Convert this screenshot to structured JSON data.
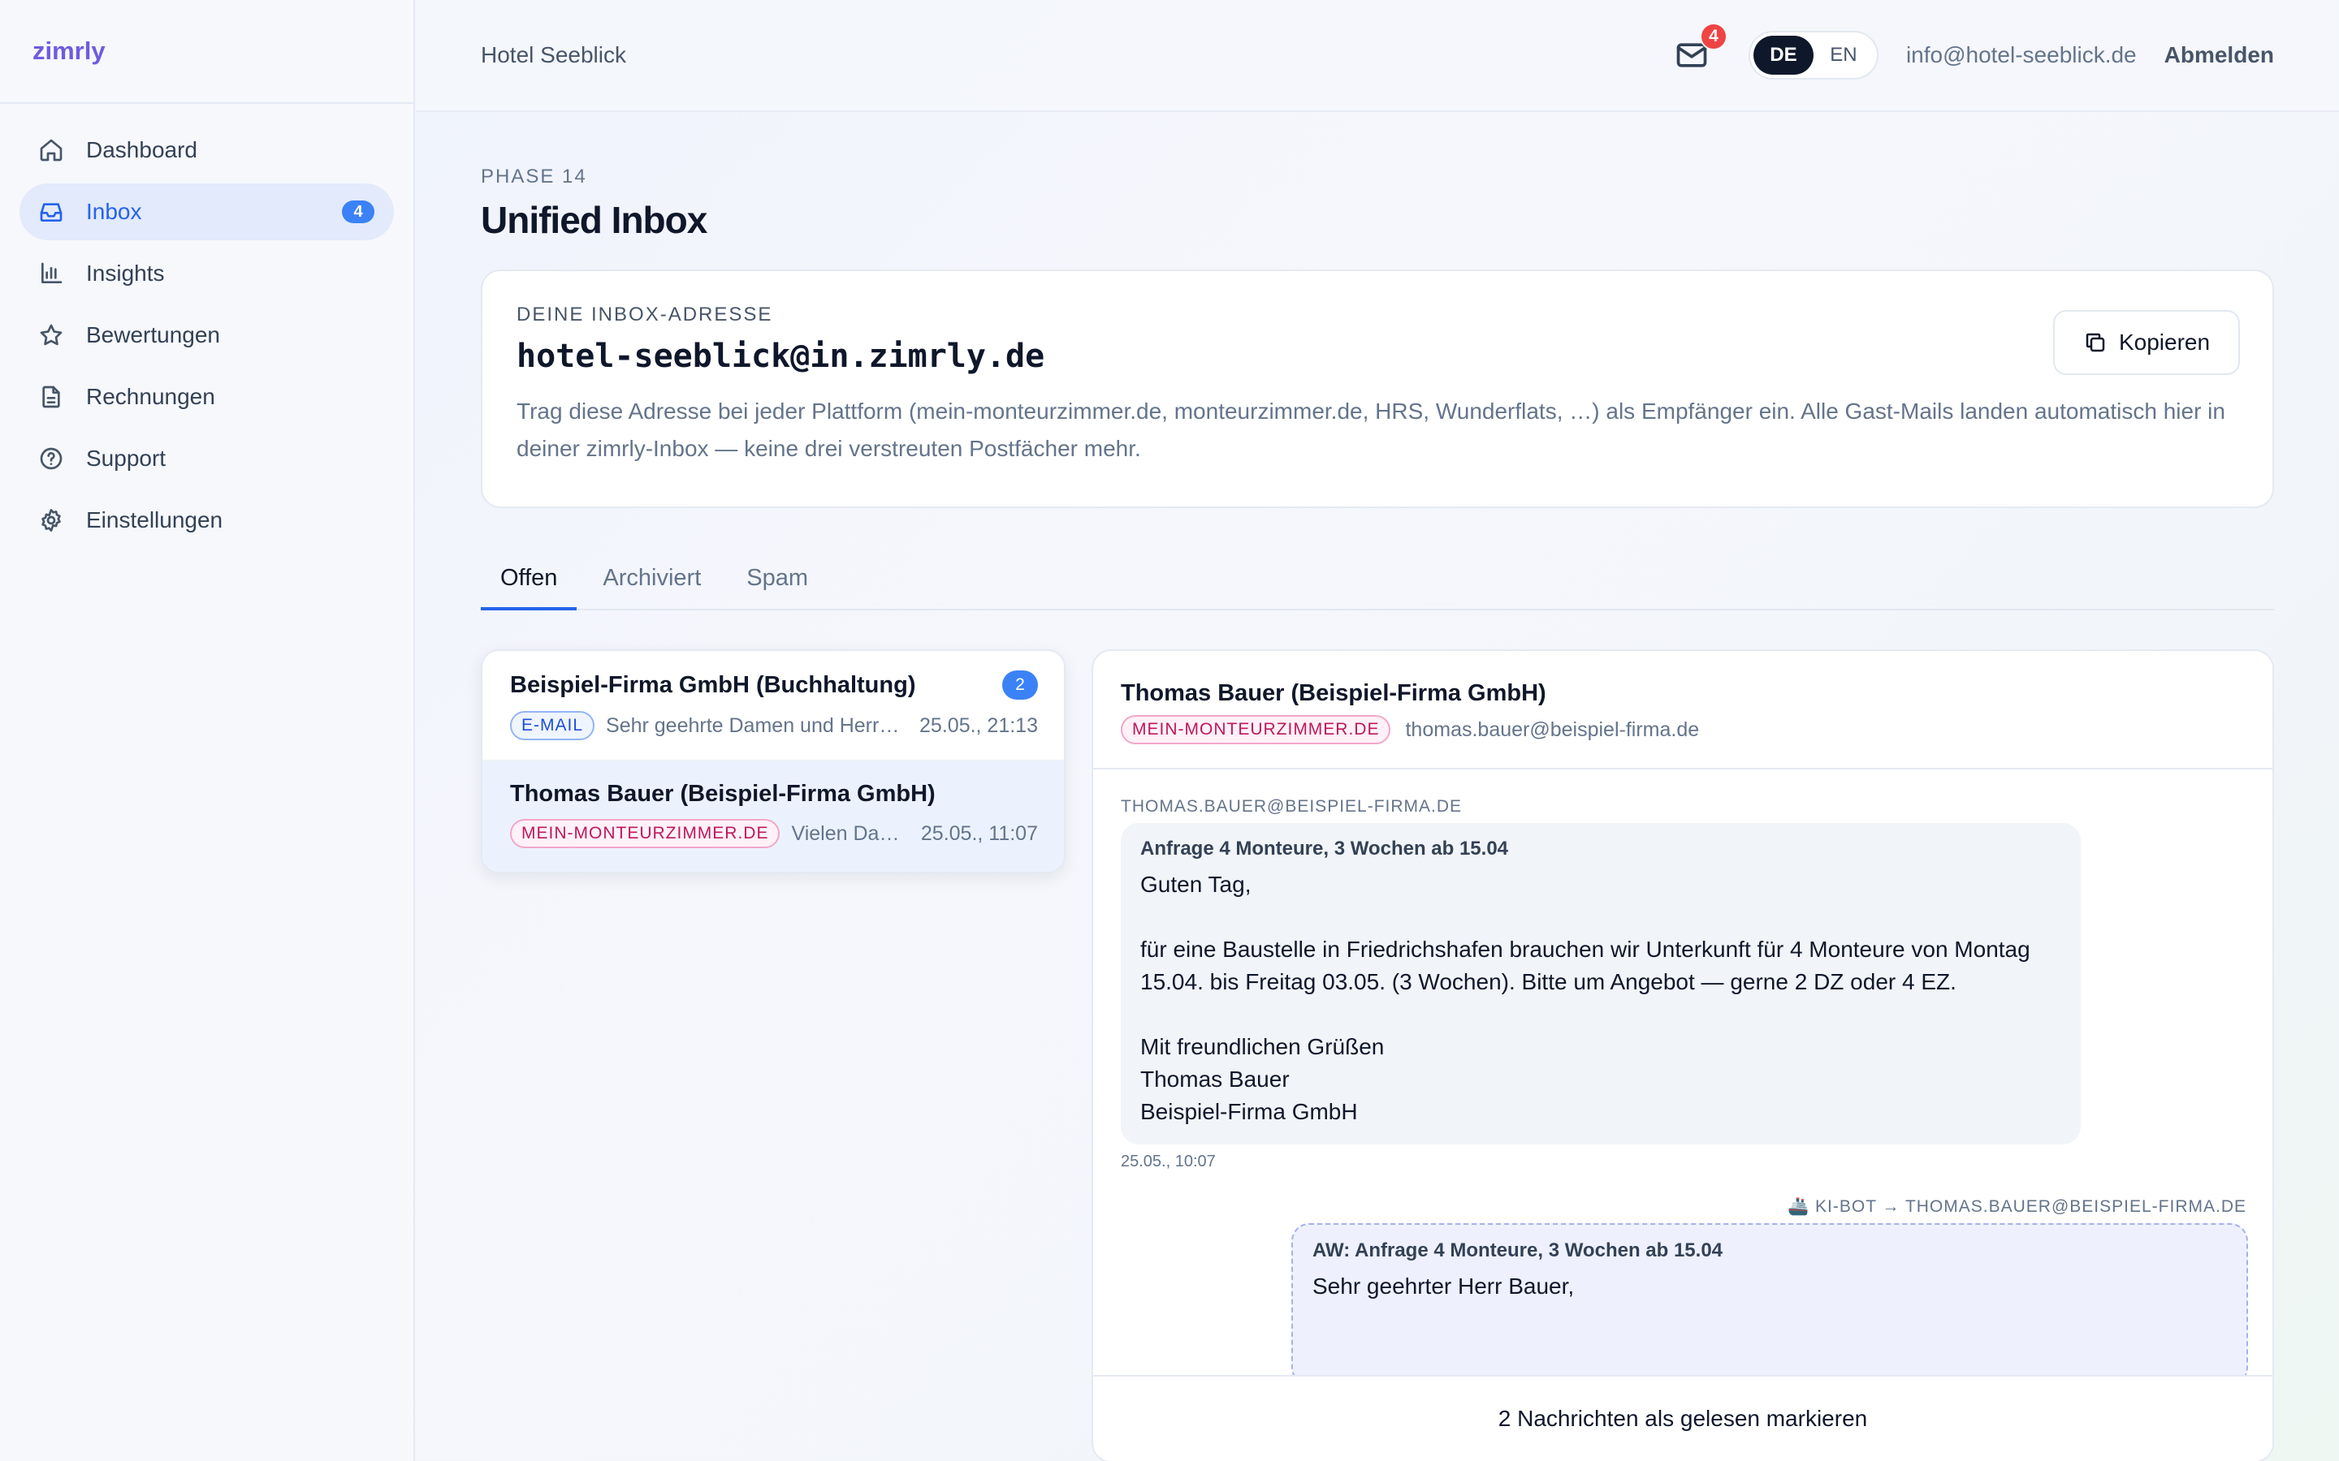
{
  "brand": "zimrly",
  "sidebar": {
    "items": [
      {
        "label": "Dashboard",
        "icon": "home-icon"
      },
      {
        "label": "Inbox",
        "icon": "inbox-icon",
        "count": "4",
        "active": true
      },
      {
        "label": "Insights",
        "icon": "bar-chart-icon"
      },
      {
        "label": "Bewertungen",
        "icon": "star-icon"
      },
      {
        "label": "Rechnungen",
        "icon": "document-icon"
      },
      {
        "label": "Support",
        "icon": "help-circle-icon"
      },
      {
        "label": "Einstellungen",
        "icon": "gear-icon"
      }
    ]
  },
  "header": {
    "hotel": "Hotel Seeblick",
    "mail_badge": "4",
    "lang": {
      "de": "DE",
      "en": "EN",
      "selected": "DE"
    },
    "user_email": "info@hotel-seeblick.de",
    "logout": "Abmelden"
  },
  "page": {
    "phase": "PHASE 14",
    "title": "Unified Inbox"
  },
  "inbox_card": {
    "label": "DEINE INBOX-ADRESSE",
    "address": "hotel-seeblick@in.zimrly.de",
    "description": "Trag diese Adresse bei jeder Plattform (mein-monteurzimmer.de, monteurzimmer.de, HRS, Wunderflats, …) als Empfänger ein. Alle Gast-Mails landen automatisch hier in deiner zimrly-Inbox — keine drei verstreuten Postfächer mehr.",
    "copy_label": "Kopieren"
  },
  "tabs": [
    "Offen",
    "Archiviert",
    "Spam"
  ],
  "conversations": [
    {
      "name": "Beispiel-Firma GmbH (Buchhaltung)",
      "count": "2",
      "tag": "E-MAIL",
      "preview": "Sehr geehrte Damen und Herren, anbei erhalten Sie",
      "date": "25.05., 21:13"
    },
    {
      "name": "Thomas Bauer (Beispiel-Firma GmbH)",
      "tag": "MEIN-MONTEURZIMMER.DE",
      "preview": "Vielen Dank für Ihre Anfrage",
      "date": "25.05., 11:07"
    }
  ],
  "detail": {
    "name": "Thomas Bauer (Beispiel-Firma GmbH)",
    "tag": "MEIN-MONTEURZIMMER.DE",
    "email": "thomas.bauer@beispiel-firma.de",
    "message": {
      "from": "THOMAS.BAUER@BEISPIEL-FIRMA.DE",
      "subject": "Anfrage 4 Monteure, 3 Wochen ab 15.04",
      "body": "Guten Tag,\n\nfür eine Baustelle in Friedrichshafen brauchen wir Unterkunft für 4 Monteure von Montag 15.04. bis Freitag 03.05. (3 Wochen). Bitte um Angebot — gerne 2 DZ oder 4 EZ.\n\nMit freundlichen Grüßen\nThomas Bauer\nBeispiel-Firma GmbH",
      "time": "25.05., 10:07"
    },
    "reply": {
      "label": "🚢 KI-BOT → THOMAS.BAUER@BEISPIEL-FIRMA.DE",
      "subject": "AW: Anfrage 4 Monteure, 3 Wochen ab 15.04",
      "body": "Sehr geehrter Herr Bauer,"
    },
    "footer": "2 Nachrichten als gelesen markieren"
  }
}
